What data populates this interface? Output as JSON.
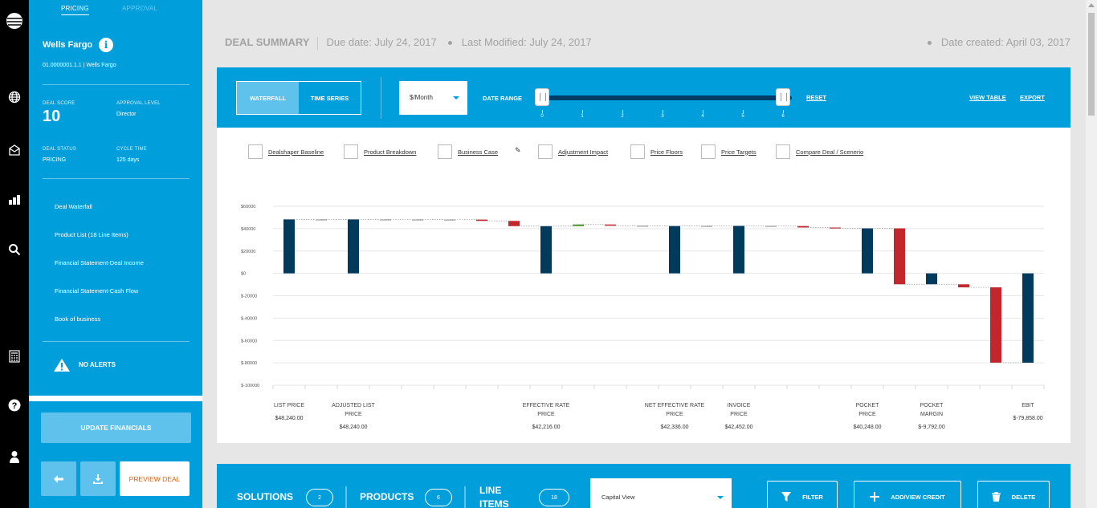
{
  "rail": {
    "icons": [
      "att-logo-icon",
      "globe-icon",
      "mail-icon",
      "bar-chart-icon",
      "search-icon",
      "calculator-icon",
      "help-icon",
      "user-icon"
    ]
  },
  "sidebar": {
    "tabs": [
      "PRICING",
      "APPROVAL"
    ],
    "account_name": "Wells Fargo",
    "account_id": "01.0000001.1.1 | Wells Fargo",
    "deal_score_label": "DEAL SCORE",
    "deal_score": "10",
    "approval_level_label": "APPROVAL LEVEL",
    "approval_level": "Director",
    "deal_status_label": "DEAL STATUS",
    "deal_status": "PRICING",
    "cycle_time_label": "CYCLE TIME",
    "cycle_time": "125 days",
    "nav": [
      "Deal Waterfall",
      "Product List (18 Line Items)",
      "Financial Statement-Deal Income",
      "Financial Statement-Cash Flow",
      "Book of business"
    ],
    "alerts": "NO ALERTS",
    "update_button": "UPDATE FINANCIALS",
    "preview_button": "PREVIEW DEAL"
  },
  "header": {
    "title": "DEAL SUMMARY",
    "due": "Due date: July 24, 2017",
    "modified": "Last Modified: July 24, 2017",
    "created": "Date created: April 03, 2017"
  },
  "toolbar": {
    "view_tabs": [
      "WATERFALL",
      "TIME SERIES"
    ],
    "unit": "$/Month",
    "date_range_label": "DATE RANGE",
    "range_ticks": [
      "0",
      "1",
      "2",
      "3",
      "4",
      "5",
      "6"
    ],
    "reset": "RESET",
    "view_table": "VIEW TABLE",
    "export": "EXPORT"
  },
  "checkboxes": [
    "Dealshaper Baseline",
    "Product Breakdown",
    "Business Case",
    "Adjustment Impact",
    "Price Floors",
    "Price Targets",
    "Compare Deal / Scenerio"
  ],
  "chart_data": {
    "type": "bar",
    "subtype": "waterfall",
    "ylim": [
      -100000,
      60000
    ],
    "yticks": [
      "$60000",
      "$40000",
      "$20000",
      "$0",
      "$-20000",
      "$-40000",
      "$-60000",
      "$-80000",
      "$-100000"
    ],
    "grid": true,
    "colors": {
      "total": "#003a5d",
      "negative": "#c1272d",
      "positive": "#4c9a2a"
    },
    "bars": [
      {
        "label": "LIST PRICE",
        "value": "$48,240.00",
        "kind": "total",
        "start": 0,
        "end": 48240
      },
      {
        "kind": "step",
        "start": 48240,
        "end": 48240
      },
      {
        "label": "ADJUSTED LIST PRICE",
        "value": "$48,240.00",
        "kind": "total",
        "start": 0,
        "end": 48240
      },
      {
        "kind": "step",
        "start": 48240,
        "end": 48200
      },
      {
        "kind": "step",
        "start": 48200,
        "end": 48150
      },
      {
        "kind": "step",
        "start": 48150,
        "end": 48100
      },
      {
        "kind": "negative",
        "start": 48100,
        "end": 46900
      },
      {
        "kind": "negative",
        "start": 46900,
        "end": 42216
      },
      {
        "label": "EFFECTIVE RATE PRICE",
        "value": "$42,216.00",
        "kind": "total",
        "start": 0,
        "end": 42216
      },
      {
        "kind": "positive",
        "start": 42216,
        "end": 43700
      },
      {
        "kind": "negative",
        "start": 43700,
        "end": 42600
      },
      {
        "kind": "step",
        "start": 42600,
        "end": 42336
      },
      {
        "label": "NET EFFECTIVE RATE PRICE",
        "value": "$42,336.00",
        "kind": "total",
        "start": 0,
        "end": 42336
      },
      {
        "kind": "step",
        "start": 42336,
        "end": 42452
      },
      {
        "label": "INVOICE PRICE",
        "value": "$42,452.00",
        "kind": "total",
        "start": 0,
        "end": 42452
      },
      {
        "kind": "step",
        "start": 42452,
        "end": 42300
      },
      {
        "kind": "negative",
        "start": 42300,
        "end": 41000
      },
      {
        "kind": "negative",
        "start": 41000,
        "end": 40248
      },
      {
        "label": "POCKET PRICE",
        "value": "$40,248.00",
        "kind": "total",
        "start": 0,
        "end": 40248
      },
      {
        "kind": "negative",
        "start": 40248,
        "end": -9792
      },
      {
        "label": "POCKET MARGIN",
        "value": "$-9,792.00",
        "kind": "total",
        "start": 0,
        "end": -9792
      },
      {
        "kind": "negative",
        "start": -9792,
        "end": -12500
      },
      {
        "kind": "negative",
        "start": -12500,
        "end": -79858
      },
      {
        "label": "EBIT",
        "value": "$-79,858.00",
        "kind": "total",
        "start": 0,
        "end": -79858
      }
    ]
  },
  "bottom": {
    "solutions_label": "SOLUTIONS",
    "solutions_count": "2",
    "products_label": "PRODUCTS",
    "products_count": "6",
    "line_items_label": "LINE ITEMS",
    "line_items_count": "18",
    "view_select": "Capital View",
    "filter": "FILTER",
    "add_credit": "ADD/VIEW CREDIT",
    "delete": "DELETE"
  }
}
